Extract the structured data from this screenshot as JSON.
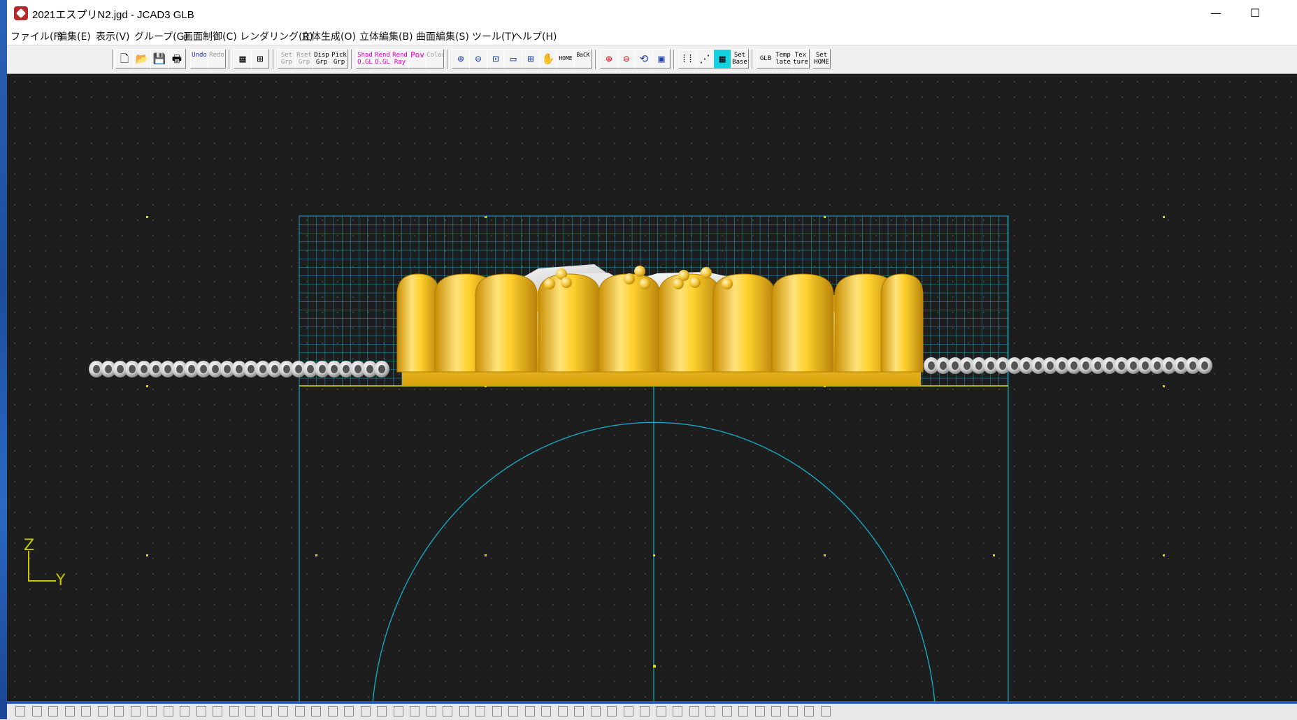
{
  "window": {
    "title": "2021エスプリN2.jgd - JCAD3 GLB",
    "minimize": "—",
    "maximize": "☐"
  },
  "menus": [
    "ファイル(F)",
    "編集(E)",
    "表示(V)",
    "グループ(G)",
    "画面制御(C)",
    "レンダリング(R)",
    "立体生成(O)",
    "立体編集(B)",
    "曲面編集(S)",
    "ツール(T)",
    "ヘルプ(H)"
  ],
  "toolbar": [
    {
      "name": "new-file-button",
      "label": "🗋"
    },
    {
      "name": "open-file-button",
      "label": "📂"
    },
    {
      "name": "save-button",
      "label": "💾"
    },
    {
      "name": "print-button",
      "label": "🖶"
    },
    {
      "name": "undo-button",
      "label": "Undo"
    },
    {
      "name": "redo-button",
      "label": "Redo"
    },
    {
      "name": "grid-view-button",
      "label": "▦"
    },
    {
      "name": "layout-view-button",
      "label": "⊞"
    },
    {
      "name": "set-group-button",
      "label": "Set Grp"
    },
    {
      "name": "reset-group-button",
      "label": "Rset Grp"
    },
    {
      "name": "display-group-button",
      "label": "Disp Grp"
    },
    {
      "name": "pick-group-button",
      "label": "Pick Grp"
    },
    {
      "name": "shade-ogl-button",
      "label": "Shad O.GL"
    },
    {
      "name": "render-ogl-button",
      "label": "Rend O.GL"
    },
    {
      "name": "render-ray-button",
      "label": "Rend Ray"
    },
    {
      "name": "pov-button",
      "label": "Pov"
    },
    {
      "name": "color-button",
      "label": "Color"
    },
    {
      "name": "zoom-in-button",
      "label": "⊕"
    },
    {
      "name": "zoom-out-button",
      "label": "⊖"
    },
    {
      "name": "zoom-fit-button",
      "label": "⊡"
    },
    {
      "name": "zoom-window-button",
      "label": "▭"
    },
    {
      "name": "zoom-area-button",
      "label": "⊞"
    },
    {
      "name": "pan-button",
      "label": "✋"
    },
    {
      "name": "home-view-button",
      "label": "HOME"
    },
    {
      "name": "back-view-button",
      "label": "BaCK"
    },
    {
      "name": "zoom-in-red-button",
      "label": "⊕"
    },
    {
      "name": "zoom-out-red-button",
      "label": "⊖"
    },
    {
      "name": "rotate-view-button",
      "label": "⟲"
    },
    {
      "name": "frame-view-button",
      "label": "▣"
    },
    {
      "name": "dot-grid-button",
      "label": "⁞⁞"
    },
    {
      "name": "snap-grid-button",
      "label": "⋰"
    },
    {
      "name": "grid-toggle-button",
      "label": "▦"
    },
    {
      "name": "set-base-button",
      "label": "Set Base"
    },
    {
      "name": "glb-button",
      "label": "GLB"
    },
    {
      "name": "template-button",
      "label": "Temp late"
    },
    {
      "name": "texture-button",
      "label": "Tex ture"
    },
    {
      "name": "set-home-button",
      "label": "Set HOME"
    }
  ],
  "viewport": {
    "axis_z": "Z",
    "axis_y": "Y"
  },
  "colors": {
    "viewport_bg": "#1d1d1d",
    "grid": "#17a7c1",
    "gold": "#f5c22e",
    "dot_marker": "#d8d800",
    "status_tick": "#2a5fd1"
  }
}
